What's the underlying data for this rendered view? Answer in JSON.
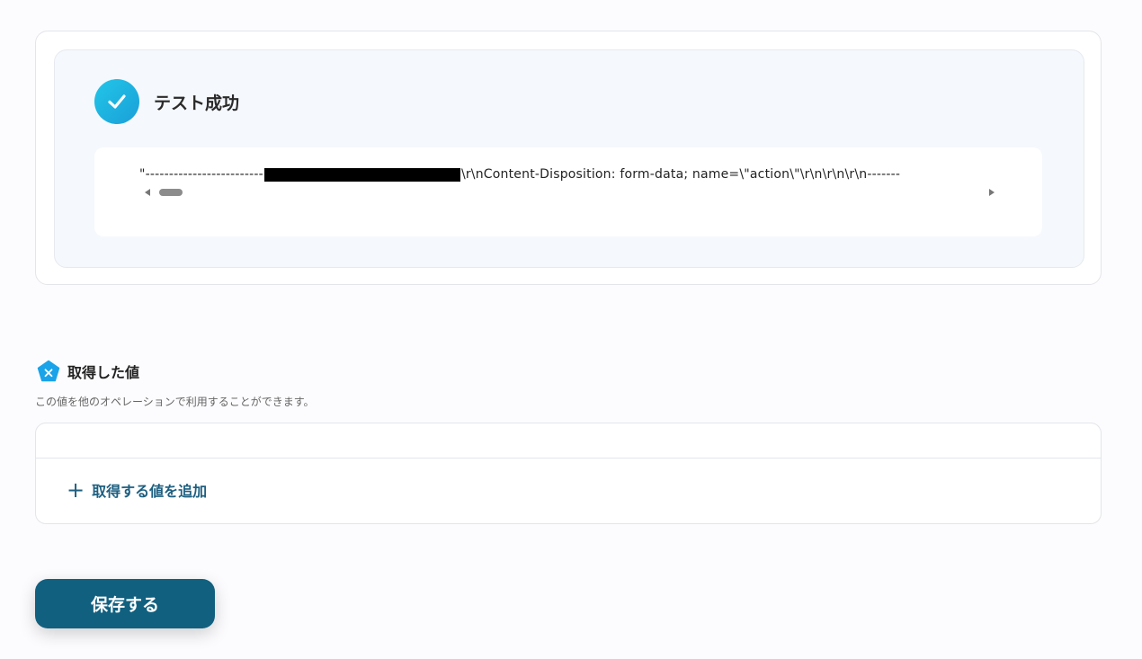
{
  "test_result": {
    "status_text": "テスト成功",
    "output_prefix": "\"-------------------------",
    "output_mid": "",
    "output_suffix": "\\r\\nContent-Disposition: form-data; name=\\\"action\\\"\\r\\n\\r\\n\\r\\n-------"
  },
  "acquired_values": {
    "title": "取得した値",
    "description": "この値を他のオペレーションで利用することができます。",
    "add_button_label": "取得する値を追加"
  },
  "save_button_label": "保存する",
  "colors": {
    "accent": "#11607f",
    "success_gradient_start": "#22c6e8",
    "success_gradient_end": "#1a9fd8",
    "pentagon_icon": "#1aa3e8"
  },
  "icons": {
    "status": "check-circle-icon",
    "values_section": "pentagon-x-icon",
    "add": "plus-icon"
  }
}
